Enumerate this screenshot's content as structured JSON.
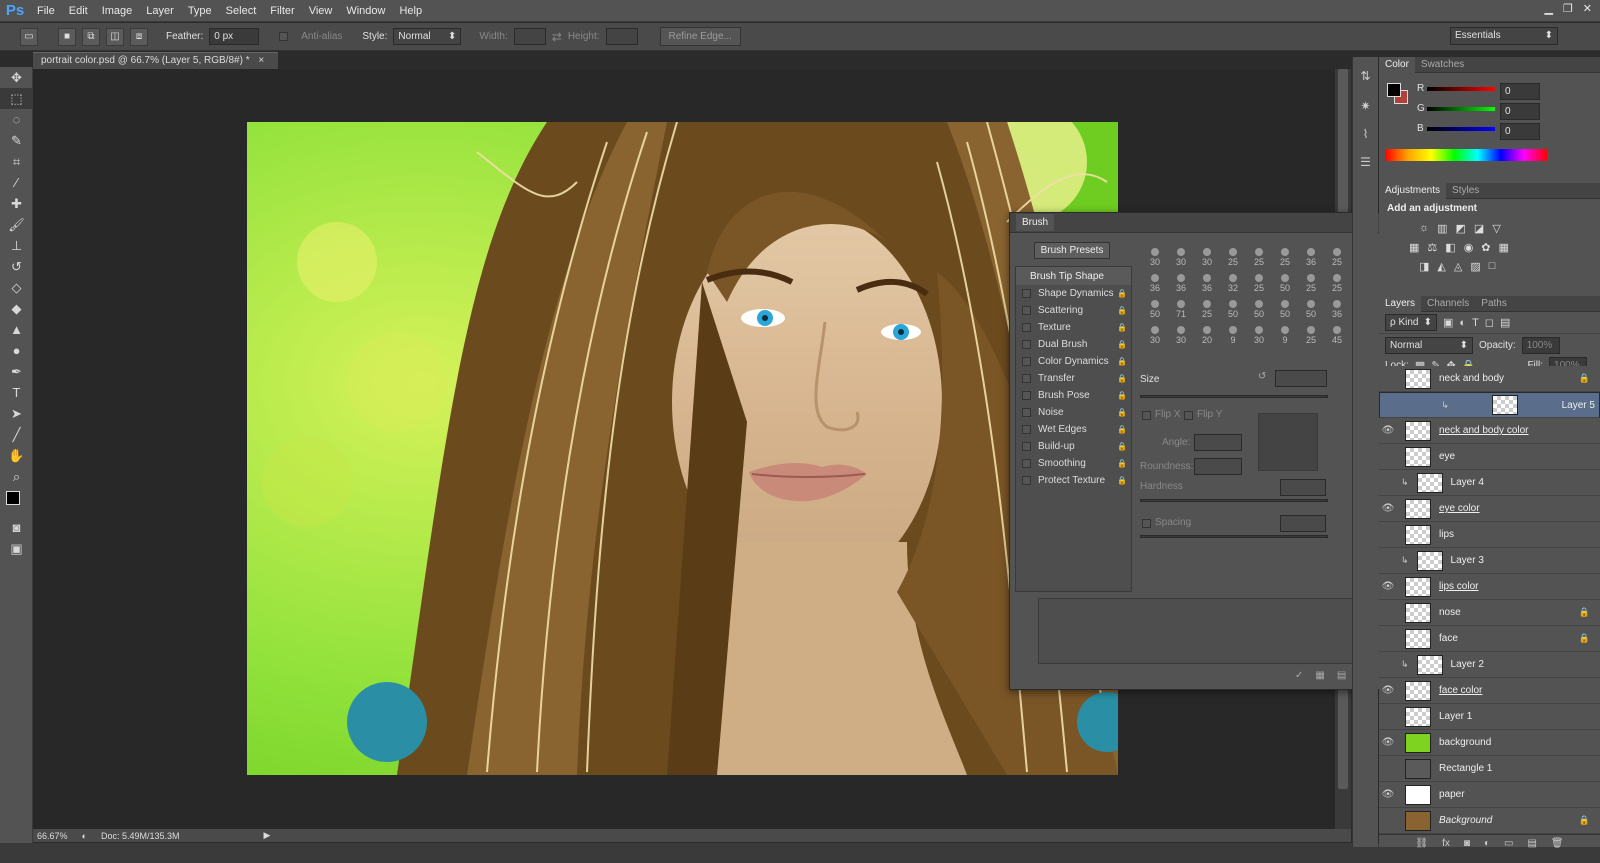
{
  "menubar": {
    "logo": "Ps",
    "items": [
      "File",
      "Edit",
      "Image",
      "Layer",
      "Type",
      "Select",
      "Filter",
      "View",
      "Window",
      "Help"
    ],
    "controls": [
      "▁",
      "❐",
      "✕"
    ]
  },
  "options": {
    "feather_label": "Feather:",
    "feather_value": "0 px",
    "antialias": "Anti-alias",
    "style_label": "Style:",
    "style_value": "Normal",
    "width_label": "Width:",
    "height_label": "Height:",
    "refine_edge": "Refine Edge...",
    "workspace": "Essentials"
  },
  "document": {
    "tab": "portrait color.psd @ 66.7% (Layer 5, RGB/8#) *",
    "close": "×"
  },
  "status": {
    "zoom": "66.67%",
    "doc": "Doc: 5.49M/135.3M"
  },
  "color_panel": {
    "tabs": [
      "Color",
      "Swatches"
    ],
    "r_label": "R",
    "g_label": "G",
    "b_label": "B",
    "r": "0",
    "g": "0",
    "b": "0",
    "fg": "#000000",
    "bg": "#b3413a"
  },
  "adjustments": {
    "tabs": [
      "Adjustments",
      "Styles"
    ],
    "title": "Add an adjustment"
  },
  "layers_panel": {
    "tabs": [
      "Layers",
      "Channels",
      "Paths"
    ],
    "kind": "ρ Kind",
    "blend": "Normal",
    "opacity_label": "Opacity:",
    "opacity": "100%",
    "lock_label": "Lock:",
    "fill_label": "Fill:",
    "fill": "100%",
    "layers": [
      {
        "name": "neck and body",
        "vis": false,
        "sel": false,
        "under": false,
        "clip": false,
        "lock": true
      },
      {
        "name": "Layer 5",
        "vis": false,
        "sel": true,
        "under": false,
        "clip": true,
        "lock": false
      },
      {
        "name": "neck and body color",
        "vis": true,
        "sel": false,
        "under": true,
        "clip": false,
        "lock": false
      },
      {
        "name": "eye",
        "vis": false,
        "sel": false,
        "under": false,
        "clip": false,
        "lock": false
      },
      {
        "name": "Layer 4",
        "vis": false,
        "sel": false,
        "under": false,
        "clip": true,
        "lock": false
      },
      {
        "name": "eye color",
        "vis": true,
        "sel": false,
        "under": true,
        "clip": false,
        "lock": false
      },
      {
        "name": "lips",
        "vis": false,
        "sel": false,
        "under": false,
        "clip": false,
        "lock": false
      },
      {
        "name": "Layer 3",
        "vis": false,
        "sel": false,
        "under": false,
        "clip": true,
        "lock": false
      },
      {
        "name": "lips color",
        "vis": true,
        "sel": false,
        "under": true,
        "clip": false,
        "lock": false
      },
      {
        "name": "nose",
        "vis": false,
        "sel": false,
        "under": false,
        "clip": false,
        "lock": true
      },
      {
        "name": "face",
        "vis": false,
        "sel": false,
        "under": false,
        "clip": false,
        "lock": true
      },
      {
        "name": "Layer 2",
        "vis": false,
        "sel": false,
        "under": false,
        "clip": true,
        "lock": false
      },
      {
        "name": "face color",
        "vis": true,
        "sel": false,
        "under": true,
        "clip": false,
        "lock": false
      },
      {
        "name": "Layer 1",
        "vis": false,
        "sel": false,
        "under": false,
        "clip": false,
        "lock": false
      },
      {
        "name": "background",
        "vis": true,
        "sel": false,
        "under": false,
        "clip": false,
        "lock": false
      },
      {
        "name": "Rectangle 1",
        "vis": false,
        "sel": false,
        "under": false,
        "clip": false,
        "lock": false
      },
      {
        "name": "paper",
        "vis": true,
        "sel": false,
        "under": false,
        "clip": false,
        "lock": false
      },
      {
        "name": "Background",
        "vis": false,
        "sel": false,
        "under": false,
        "clip": false,
        "lock": true,
        "italic": true
      }
    ]
  },
  "brush": {
    "title": "Brush",
    "presets_btn": "Brush Presets",
    "tip_shape": "Brush Tip Shape",
    "options": [
      "Shape Dynamics",
      "Scattering",
      "Texture",
      "Dual Brush",
      "Color Dynamics",
      "Transfer",
      "Brush Pose",
      "Noise",
      "Wet Edges",
      "Build-up",
      "Smoothing",
      "Protect Texture"
    ],
    "sizes": [
      "30",
      "30",
      "30",
      "25",
      "25",
      "25",
      "36",
      "25",
      "36",
      "36",
      "36",
      "32",
      "25",
      "50",
      "25",
      "25",
      "50",
      "71",
      "25",
      "50",
      "50",
      "50",
      "50",
      "36",
      "30",
      "30",
      "20",
      "9",
      "30",
      "9",
      "25",
      "45"
    ],
    "size_label": "Size",
    "flipx": "Flip X",
    "flipy": "Flip Y",
    "angle_label": "Angle:",
    "roundness_label": "Roundness:",
    "hardness_label": "Hardness",
    "spacing_label": "Spacing"
  }
}
